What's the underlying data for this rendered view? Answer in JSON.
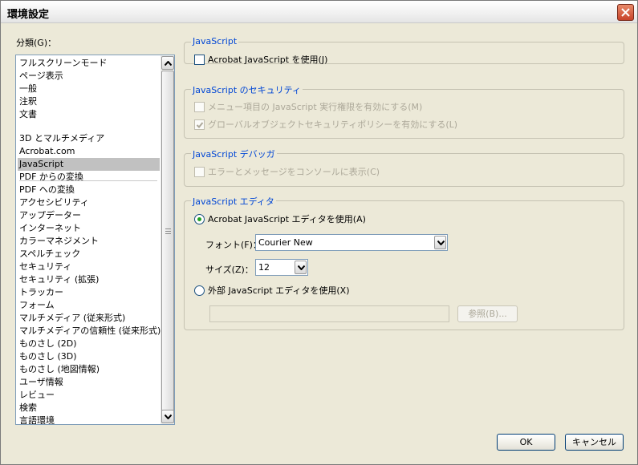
{
  "window": {
    "title": "環境設定",
    "close_icon": "close-icon"
  },
  "categories": {
    "label": "分類(G)：",
    "items": [
      "フルスクリーンモード",
      "ページ表示",
      "一般",
      "注釈",
      "文書",
      "3D とマルチメディア",
      "Acrobat.com",
      "JavaScript",
      "PDF からの変換",
      "PDF への変換",
      "アクセシビリティ",
      "アップデーター",
      "インターネット",
      "カラーマネジメント",
      "スペルチェック",
      "セキュリティ",
      "セキュリティ (拡張)",
      "トラッカー",
      "フォーム",
      "マルチメディア (従来形式)",
      "マルチメディアの信頼性 (従来形式)",
      "ものさし (2D)",
      "ものさし (3D)",
      "ものさし (地図情報)",
      "ユーザ情報",
      "レビュー",
      "検索",
      "言語環境"
    ],
    "selected": "JavaScript"
  },
  "group_javascript": {
    "legend": "JavaScript",
    "enable_label": "Acrobat JavaScript を使用(J)",
    "enable_checked": false
  },
  "group_security": {
    "legend": "JavaScript のセキュリティ",
    "menu_label": "メニュー項目の JavaScript 実行権限を有効にする(M)",
    "menu_checked": false,
    "global_label": "グローバルオブジェクトセキュリティポリシーを有効にする(L)",
    "global_checked": true
  },
  "group_debugger": {
    "legend": "JavaScript デバッガ",
    "console_label": "エラーとメッセージをコンソールに表示(C)",
    "console_checked": false
  },
  "group_editor": {
    "legend": "JavaScript エディタ",
    "acrobat_editor_label": "Acrobat JavaScript エディタを使用(A)",
    "font_label": "フォント(F)：",
    "font_value": "Courier New",
    "size_label": "サイズ(Z)：",
    "size_value": "12",
    "external_editor_label": "外部 JavaScript エディタを使用(X)",
    "external_path_value": "",
    "browse_label": "参照(B)..."
  },
  "buttons": {
    "ok": "OK",
    "cancel": "キャンセル"
  }
}
